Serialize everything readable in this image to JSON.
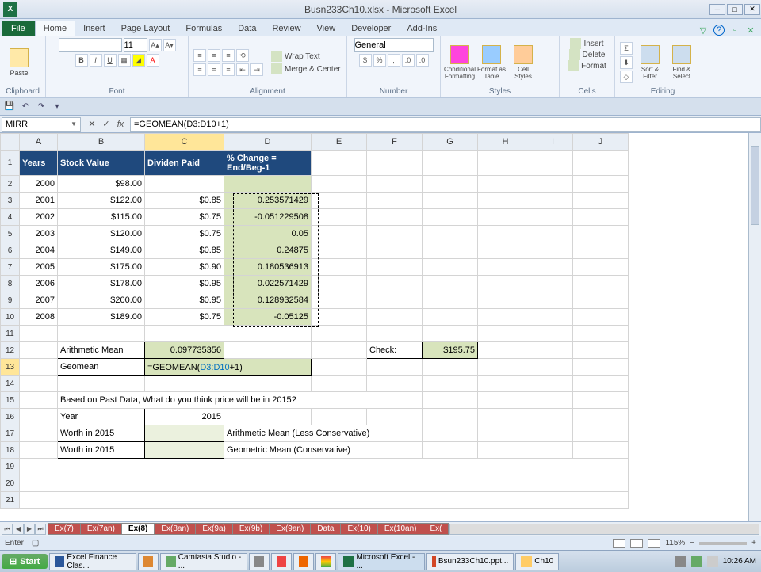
{
  "window": {
    "title": "Busn233Ch10.xlsx - Microsoft Excel"
  },
  "tabs": {
    "file": "File",
    "list": [
      "Home",
      "Insert",
      "Page Layout",
      "Formulas",
      "Data",
      "Review",
      "View",
      "Developer",
      "Add-Ins"
    ],
    "activeIndex": 0
  },
  "ribbon": {
    "clipboard": {
      "label": "Clipboard",
      "paste": "Paste"
    },
    "font": {
      "label": "Font",
      "size": "11"
    },
    "alignment": {
      "label": "Alignment",
      "wrap": "Wrap Text",
      "merge": "Merge & Center"
    },
    "number": {
      "label": "Number",
      "format": "General"
    },
    "styles": {
      "label": "Styles",
      "cond": "Conditional Formatting",
      "table": "Format as Table",
      "cell": "Cell Styles"
    },
    "cells": {
      "label": "Cells",
      "insert": "Insert",
      "delete": "Delete",
      "format": "Format"
    },
    "editing": {
      "label": "Editing",
      "sort": "Sort & Filter",
      "find": "Find & Select"
    }
  },
  "nameBox": "MIRR",
  "formula": "=GEOMEAN(D3:D10+1)",
  "cols": [
    "A",
    "B",
    "C",
    "D",
    "E",
    "F",
    "G",
    "H",
    "I",
    "J"
  ],
  "headers": {
    "A": "Years",
    "B": "Stock Value",
    "C": "Dividen Paid",
    "D": "% Change = End/Beg-1"
  },
  "rows": [
    {
      "r": 2,
      "A": "2000",
      "B": "$98.00",
      "C": "",
      "D": ""
    },
    {
      "r": 3,
      "A": "2001",
      "B": "$122.00",
      "C": "$0.85",
      "D": "0.253571429"
    },
    {
      "r": 4,
      "A": "2002",
      "B": "$115.00",
      "C": "$0.75",
      "D": "-0.051229508"
    },
    {
      "r": 5,
      "A": "2003",
      "B": "$120.00",
      "C": "$0.75",
      "D": "0.05"
    },
    {
      "r": 6,
      "A": "2004",
      "B": "$149.00",
      "C": "$0.85",
      "D": "0.24875"
    },
    {
      "r": 7,
      "A": "2005",
      "B": "$175.00",
      "C": "$0.90",
      "D": "0.180536913"
    },
    {
      "r": 8,
      "A": "2006",
      "B": "$178.00",
      "C": "$0.95",
      "D": "0.022571429"
    },
    {
      "r": 9,
      "A": "2007",
      "B": "$200.00",
      "C": "$0.95",
      "D": "0.128932584"
    },
    {
      "r": 10,
      "A": "2008",
      "B": "$189.00",
      "C": "$0.75",
      "D": "-0.05125"
    }
  ],
  "labels": {
    "arith": "Arithmetic Mean",
    "arithVal": "0.097735356",
    "geo": "Geomean",
    "editFn": "=GEOMEAN(",
    "editRef": "D3:D10",
    "editRest": "+1)",
    "check": "Check:",
    "checkVal": "$195.75",
    "question": "Based on Past Data, What do you think price will be in 2015?",
    "year": "Year",
    "yearVal": "2015",
    "worth": "Worth in 2015",
    "arithNote": "Arithmetic Mean (Less Conservative)",
    "geoNote": "Geometric Mean (Conservative)"
  },
  "sheets": {
    "list": [
      "Ex(7)",
      "Ex(7an)",
      "Ex(8)",
      "Ex(8an)",
      "Ex(9a)",
      "Ex(9b)",
      "Ex(9an)",
      "Data",
      "Ex(10)",
      "Ex(10an)",
      "Ex("
    ],
    "activeIndex": 2
  },
  "status": {
    "mode": "Enter",
    "zoom": "115%"
  },
  "taskbar": {
    "start": "Start",
    "items": [
      "Excel Finance Clas...",
      "",
      "Camtasia Studio - ...",
      "",
      "",
      "",
      "",
      "Microsoft Excel - ...",
      "Bsun233Ch10.ppt...",
      "Ch10"
    ],
    "activeIndex": 7,
    "time": "10:26 AM"
  }
}
